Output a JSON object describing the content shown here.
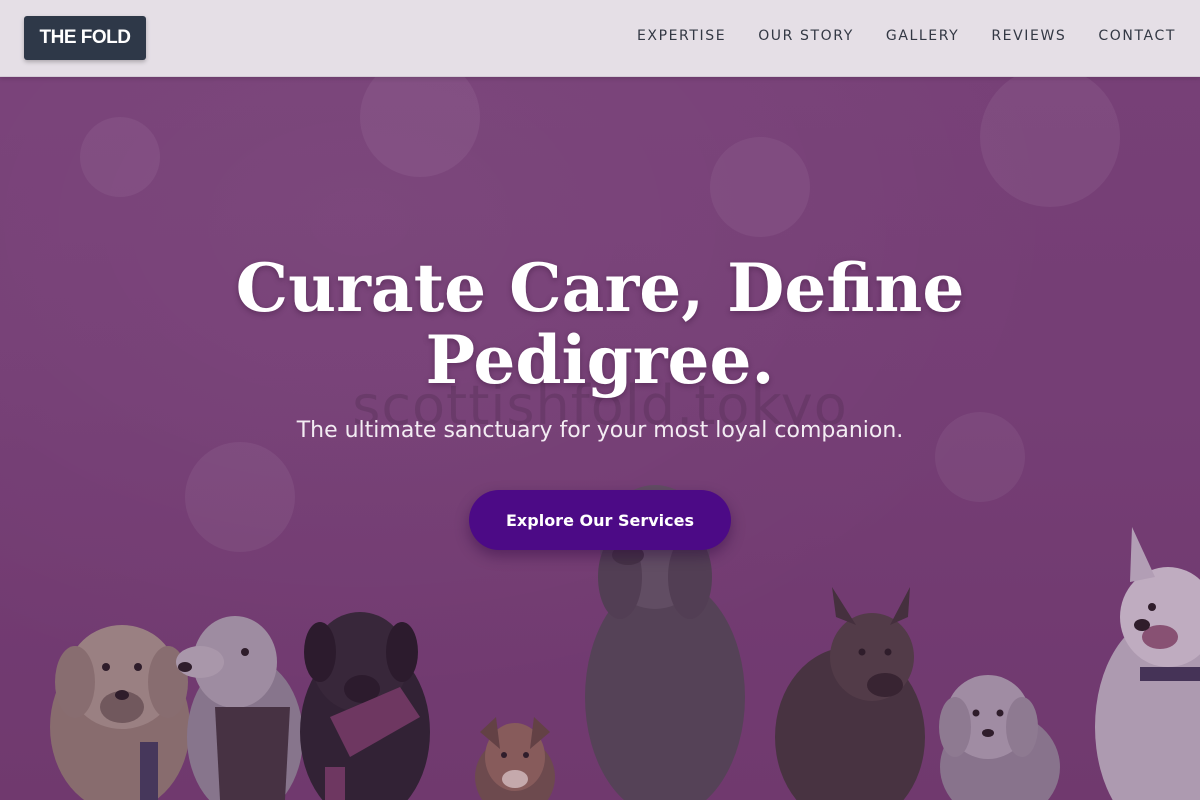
{
  "header": {
    "logo_text": "THE FOLD",
    "nav": [
      "EXPERTISE",
      "OUR STORY",
      "GALLERY",
      "REVIEWS",
      "CONTACT"
    ]
  },
  "hero": {
    "title_line1": "Curate Care, Define",
    "title_line2": "Pedigree.",
    "subtitle": "The ultimate sanctuary for your most loyal companion.",
    "cta_label": "Explore Our Services",
    "watermark": "scottishfold.tokyo"
  },
  "colors": {
    "nav_bg": "#e5dfe6",
    "logo_bg": "#2e3848",
    "hero_overlay": "#744274",
    "cta_bg": "#4c0a86",
    "text_light": "#ffffff"
  }
}
